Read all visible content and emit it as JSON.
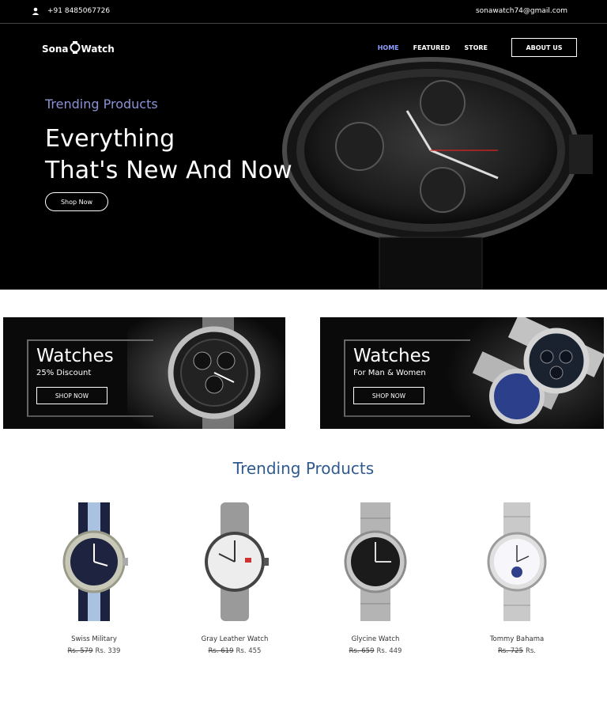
{
  "topbar": {
    "phone": "+91 8485067726",
    "email": "sonawatch74@gmail.com"
  },
  "brand": {
    "before": "Sona",
    "after": "Watch"
  },
  "nav": {
    "items": [
      "HOME",
      "FEATURED",
      "STORE"
    ],
    "about": "ABOUT US"
  },
  "hero": {
    "subtitle": "Trending Products",
    "line1": "Everything",
    "line2": "That's New And Now",
    "cta": "Shop Now"
  },
  "banners": [
    {
      "title": "Watches",
      "desc": "25% Discount",
      "cta": "SHOP NOW"
    },
    {
      "title": "Watches",
      "desc": "For Man & Women",
      "cta": "SHOP NOW"
    }
  ],
  "trending": {
    "title": "Trending Products",
    "products": [
      {
        "name": "Swiss Military",
        "old_price": "Rs. 579",
        "price": "Rs. 339"
      },
      {
        "name": "Gray Leather Watch",
        "old_price": "Rs. 619",
        "price": "Rs. 455"
      },
      {
        "name": "Glycine Watch",
        "old_price": "Rs. 659",
        "price": "Rs. 449"
      },
      {
        "name": "Tommy Bahama",
        "old_price": "Rs. 725",
        "price": "Rs."
      }
    ]
  },
  "colors": {
    "accent": "#8ea0ff",
    "section_title": "#2f5a8e",
    "hero_bg": "#000000"
  }
}
